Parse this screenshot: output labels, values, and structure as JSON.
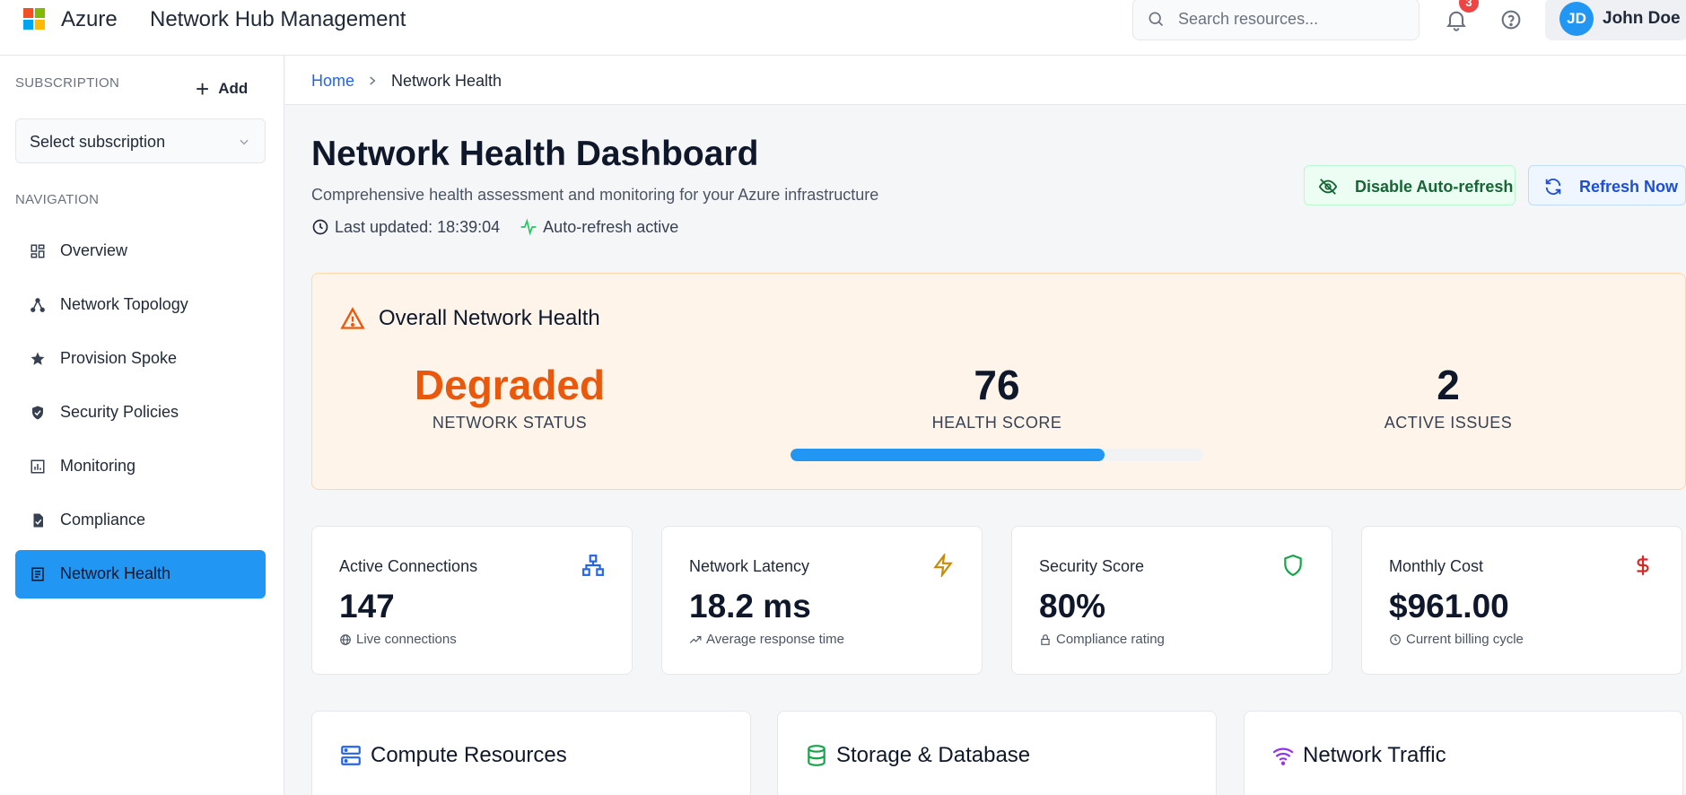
{
  "topbar": {
    "brand": "Azure",
    "title": "Network Hub Management",
    "search_placeholder": "Search resources...",
    "notification_count": "3",
    "user_initials": "JD",
    "user_name": "John Doe",
    "logo_colors": [
      "#f25022",
      "#7fba00",
      "#00a4ef",
      "#ffb900"
    ]
  },
  "sidebar": {
    "subscription_label": "SUBSCRIPTION",
    "add_label": "Add",
    "subscription_select": "Select subscription",
    "navigation_label": "NAVIGATION",
    "items": [
      {
        "label": "Overview",
        "icon": "grid-icon",
        "active": false
      },
      {
        "label": "Network Topology",
        "icon": "topology-icon",
        "active": false
      },
      {
        "label": "Provision Spoke",
        "icon": "star-icon",
        "active": false
      },
      {
        "label": "Security Policies",
        "icon": "shield-check-icon",
        "active": false
      },
      {
        "label": "Monitoring",
        "icon": "chart-icon",
        "active": false
      },
      {
        "label": "Compliance",
        "icon": "clipboard-check-icon",
        "active": false
      },
      {
        "label": "Network Health",
        "icon": "document-icon",
        "active": true
      }
    ]
  },
  "breadcrumb": {
    "home": "Home",
    "current": "Network Health"
  },
  "page": {
    "title": "Network Health Dashboard",
    "subtitle": "Comprehensive health assessment and monitoring for your Azure infrastructure",
    "last_updated": "Last updated: 18:39:04",
    "auto_refresh_status": "Auto-refresh active",
    "disable_button": "Disable Auto-refresh",
    "refresh_button": "Refresh Now"
  },
  "health": {
    "title": "Overall Network Health",
    "status_value": "Degraded",
    "status_label": "NETWORK STATUS",
    "score_value": "76",
    "score_label": "HEALTH SCORE",
    "score_fraction": 0.76,
    "issues_value": "2",
    "issues_label": "ACTIVE ISSUES"
  },
  "stats": [
    {
      "title": "Active Connections",
      "value": "147",
      "foot": "Live connections",
      "icon": "network-icon",
      "foot_icon": "globe-icon",
      "color": "#2563eb"
    },
    {
      "title": "Network Latency",
      "value": "18.2 ms",
      "foot": "Average response time",
      "icon": "lightning-icon",
      "foot_icon": "trending-up-icon",
      "color": "#ca8a04"
    },
    {
      "title": "Security Score",
      "value": "80%",
      "foot": "Compliance rating",
      "icon": "shield-icon",
      "foot_icon": "lock-icon",
      "color": "#16a34a"
    },
    {
      "title": "Monthly Cost",
      "value": "$961.00",
      "foot": "Current billing cycle",
      "icon": "dollar-icon",
      "foot_icon": "clock-icon",
      "color": "#dc2626"
    }
  ],
  "sections": [
    {
      "title": "Compute Resources",
      "icon": "server-icon",
      "color": "#2563eb"
    },
    {
      "title": "Storage & Database",
      "icon": "database-icon",
      "color": "#16a34a"
    },
    {
      "title": "Network Traffic",
      "icon": "wifi-icon",
      "color": "#9333ea"
    }
  ],
  "colors": {
    "accent": "#2196f3",
    "degraded": "#ea580c",
    "link": "#2563eb"
  }
}
